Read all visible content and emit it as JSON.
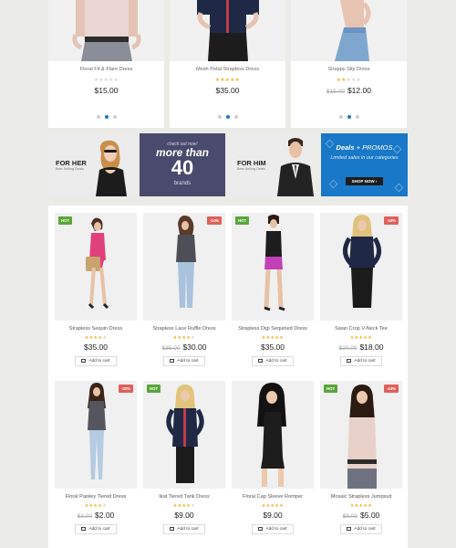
{
  "top_products": [
    {
      "name": "Floral Fit & Flare Dress",
      "rating": 0,
      "old_price": "",
      "price": "$15.00",
      "active_dot": 1
    },
    {
      "name": "Mesh Petal Strapless Dress",
      "rating": 5,
      "old_price": "",
      "price": "$35.00",
      "active_dot": 1
    },
    {
      "name": "Strappy Slip Dress",
      "rating": 2,
      "old_price": "$15.00",
      "price": "$12.00",
      "active_dot": 1
    }
  ],
  "banners": {
    "her": {
      "title": "FOR HER",
      "subtitle": "Best Selling Deals"
    },
    "promo40": {
      "line1": "check out now!",
      "line2": "more than",
      "big": "40",
      "line4": "brands"
    },
    "him": {
      "title": "FOR HIM",
      "subtitle": "Best Selling Deals"
    },
    "deals": {
      "title": "Deals",
      "title2": "+ PROMOS",
      "text": "Limited sales in our categories",
      "button": "SHOP NOW ›"
    }
  },
  "grid_products": [
    {
      "name": "Strapless Sequin Dress",
      "badge": "HOT",
      "badge_type": "hot",
      "rating": 4,
      "old_price": "",
      "price": "$35.00",
      "cart": "Add to cart"
    },
    {
      "name": "Strapless Lace Ruffle Dress",
      "badge": "-14%",
      "badge_type": "sale",
      "rating": 4,
      "old_price": "$35.00",
      "price": "$30.00",
      "cart": "Add to cart"
    },
    {
      "name": "Strapless Digi Sequined Dress",
      "badge": "HOT",
      "badge_type": "hot",
      "rating": 5,
      "old_price": "",
      "price": "$35.00",
      "cart": "Add to cart"
    },
    {
      "name": "Swan Crop V-Neck Tee",
      "badge": "-10%",
      "badge_type": "sale",
      "rating": 5,
      "old_price": "$20.00",
      "price": "$18.00",
      "cart": "Add to cart"
    },
    {
      "name": "Floral Paisley Tiered Dress",
      "badge": "-33%",
      "badge_type": "sale",
      "rating": 4,
      "old_price": "$3.00",
      "price": "$2.00",
      "cart": "Add to cart"
    },
    {
      "name": "Ikat Tiered Tank Dress",
      "badge": "HOT",
      "badge_type": "hot",
      "rating": 4,
      "old_price": "",
      "price": "$9.00",
      "cart": "Add to cart"
    },
    {
      "name": "Floral Cap Sleeve Romper",
      "badge": "",
      "badge_type": "",
      "rating": 5,
      "old_price": "",
      "price": "$9.00",
      "cart": "Add to cart"
    },
    {
      "name": "Mosaic Strapless Jumpsuit",
      "badge": "HOT",
      "badge_type": "hot",
      "badge2": "-44%",
      "rating": 5,
      "old_price": "$9.00",
      "price": "$5.00",
      "cart": "Add to cart"
    }
  ],
  "colors": {
    "accent_blue": "#1978c7",
    "hot": "#59a63a",
    "sale": "#e0605a",
    "star": "#f2b01e",
    "promo_bg": "#4a4a6e"
  }
}
